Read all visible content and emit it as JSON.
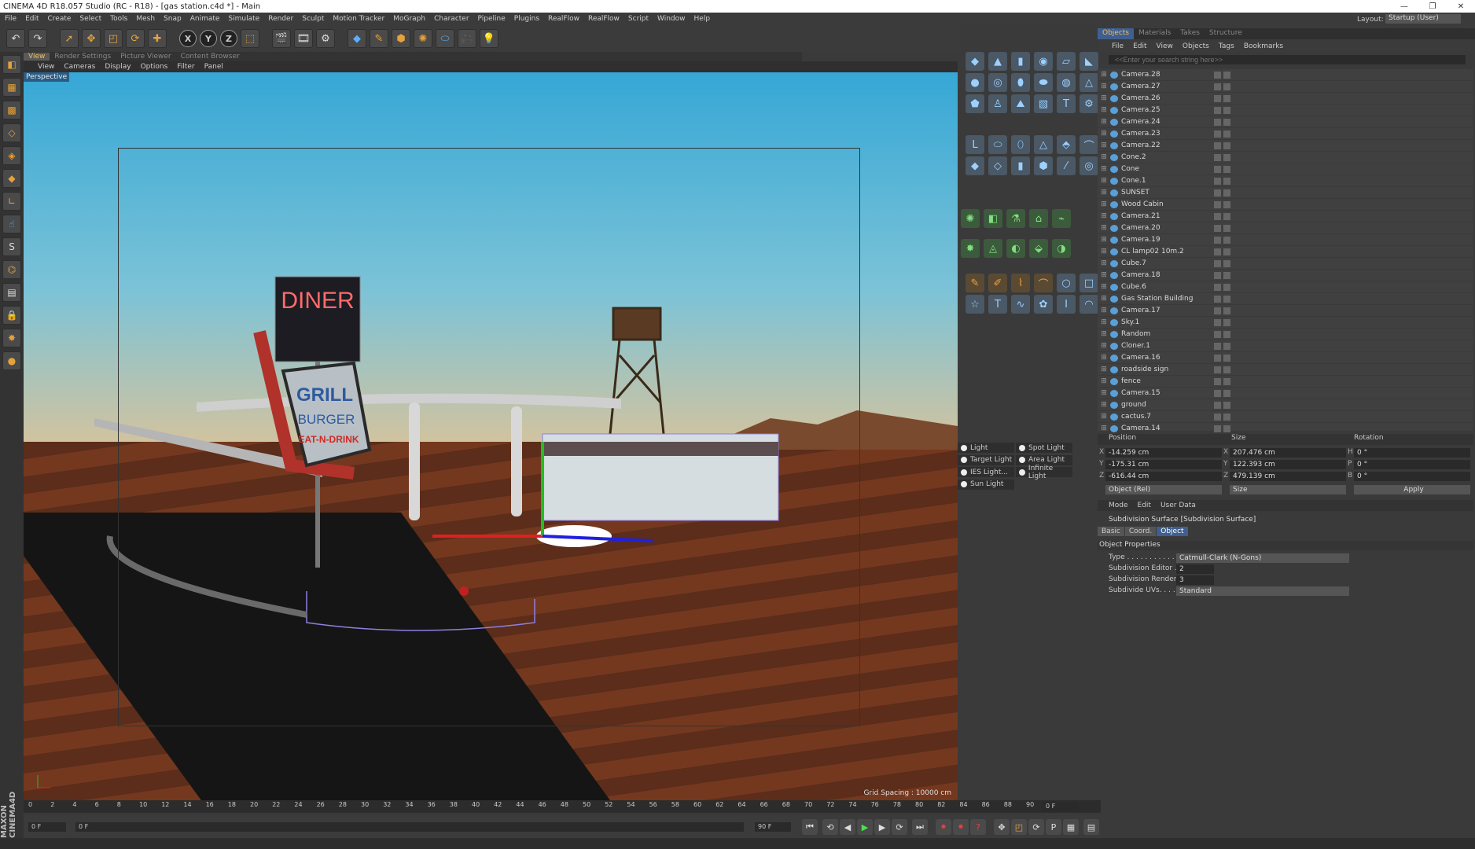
{
  "window": {
    "title": "CINEMA 4D R18.057 Studio (RC - R18) - [gas station.c4d *] - Main",
    "layout_label": "Layout:",
    "layout_value": "Startup (User)"
  },
  "menu": [
    "File",
    "Edit",
    "Create",
    "Select",
    "Tools",
    "Mesh",
    "Snap",
    "Animate",
    "Simulate",
    "Render",
    "Sculpt",
    "Motion Tracker",
    "MoGraph",
    "Character",
    "Pipeline",
    "Plugins",
    "RealFlow",
    "RealFlow",
    "Script",
    "Window",
    "Help"
  ],
  "viewport_tabs": [
    "View",
    "Render Settings",
    "Picture Viewer",
    "Content Browser"
  ],
  "viewport_menu": [
    "View",
    "Cameras",
    "Display",
    "Options",
    "Filter",
    "Panel"
  ],
  "viewport": {
    "label": "Perspective",
    "grid_spacing": "Grid Spacing : 10000 cm",
    "sign_lines": [
      "GRILL",
      "BURGER",
      "EAT-N-DRINK"
    ],
    "diner_sign": "DINER"
  },
  "lights": [
    "Light",
    "Spot Light",
    "Target Light",
    "Area Light",
    "IES Light...",
    "Infinite Light",
    "Sun Light"
  ],
  "manager_tabs": [
    "Objects",
    "Materials",
    "Takes",
    "Structure"
  ],
  "manager_menu": [
    "File",
    "Edit",
    "View",
    "Objects",
    "Tags",
    "Bookmarks"
  ],
  "search_placeholder": "<<Enter your search string here>>",
  "objects": [
    "Camera.28",
    "Camera.27",
    "Camera.26",
    "Camera.25",
    "Camera.24",
    "Camera.23",
    "Camera.22",
    "Cone.2",
    "Cone",
    "Cone.1",
    "SUNSET",
    "Wood Cabin",
    "Camera.21",
    "Camera.20",
    "Camera.19",
    "CL lamp02 10m.2",
    "Cube.7",
    "Camera.18",
    "Cube.6",
    "Gas Station Building",
    "Camera.17",
    "Sky.1",
    "Random",
    "Cloner.1",
    "Camera.16",
    "roadside sign",
    "fence",
    "Camera.15",
    "ground",
    "cactus.7",
    "Camera.14"
  ],
  "coords": {
    "headers": [
      "Position",
      "Size",
      "Rotation"
    ],
    "rows": [
      {
        "axis": "X",
        "pos": "-14.259 cm",
        "size_axis": "X",
        "size": "207.476 cm",
        "rot_axis": "H",
        "rot": "0 °"
      },
      {
        "axis": "Y",
        "pos": "-175.31 cm",
        "size_axis": "Y",
        "size": "122.393 cm",
        "rot_axis": "P",
        "rot": "0 °"
      },
      {
        "axis": "Z",
        "pos": "-616.44 cm",
        "size_axis": "Z",
        "size": "479.139 cm",
        "rot_axis": "B",
        "rot": "0 °"
      }
    ],
    "mode": "Object (Rel)",
    "size_mode": "Size",
    "apply": "Apply"
  },
  "attributes": {
    "menu": [
      "Mode",
      "Edit",
      "User Data"
    ],
    "title": "Subdivision Surface [Subdivision Surface]",
    "tabs": [
      "Basic",
      "Coord.",
      "Object"
    ],
    "section": "Object Properties",
    "props": [
      {
        "label": "Type . . . . . . . . . . . . .",
        "value": "Catmull-Clark (N-Gons)"
      },
      {
        "label": "Subdivision Editor . .",
        "value": "2"
      },
      {
        "label": "Subdivision Renderer",
        "value": "3"
      },
      {
        "label": "Subdivide UVs. . . . . . .",
        "value": "Standard"
      }
    ]
  },
  "timeline": {
    "ticks": [
      "0",
      "2",
      "4",
      "6",
      "8",
      "10",
      "12",
      "14",
      "16",
      "18",
      "20",
      "22",
      "24",
      "26",
      "28",
      "30",
      "32",
      "34",
      "36",
      "38",
      "40",
      "42",
      "44",
      "46",
      "48",
      "50",
      "52",
      "54",
      "56",
      "58",
      "60",
      "62",
      "64",
      "66",
      "68",
      "70",
      "72",
      "74",
      "76",
      "78",
      "80",
      "82",
      "84",
      "86",
      "88",
      "90"
    ],
    "current": "0 F",
    "start": "0 F",
    "start2": "0 F",
    "end": "90 F",
    "end2": "90 F"
  }
}
